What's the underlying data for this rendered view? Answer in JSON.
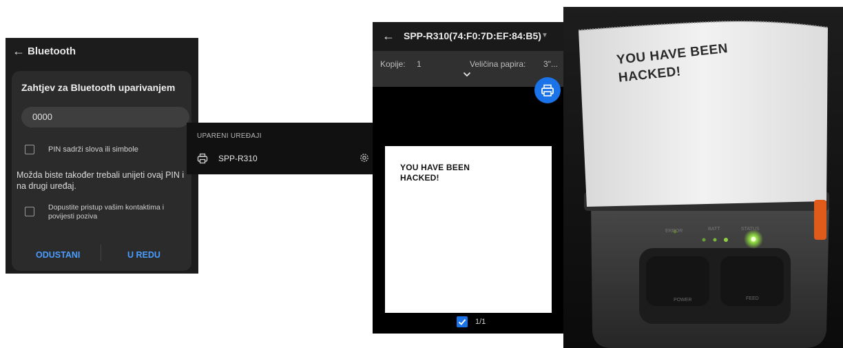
{
  "bluetooth_panel": {
    "title": "Bluetooth",
    "dialog_title": "Zahtjev za Bluetooth uparivanjem",
    "pin_value": "0000",
    "checkbox_pin_label": "PIN sadrži slova ili simbole",
    "note": "Možda biste također trebali unijeti ovaj PIN i na drugi uređaj.",
    "checkbox_contacts_label": "Dopustite pristup vašim kontaktima i povijesti poziva",
    "cancel_label": "ODUSTANI",
    "ok_label": "U REDU"
  },
  "paired_panel": {
    "header": "UPARENI UREĐAJI",
    "device_name": "SPP-R310"
  },
  "print_panel": {
    "title": "SPP-R310(74:F0:7D:EF:84:B5)",
    "copies_label": "Kopije:",
    "copies_value": "1",
    "paper_size_label": "Veličina papira:",
    "paper_size_value": "3\"...",
    "preview_text": "YOU HAVE BEEN HACKED!",
    "page_indicator": "1/1",
    "accent_color": "#1a73e8"
  },
  "photo_panel": {
    "printed_text": "YOU HAVE BEEN HACKED!",
    "led_labels": {
      "error": "ERROR",
      "batt": "BATT",
      "status": "STATUS"
    },
    "button_labels": {
      "power": "POWER",
      "feed": "FEED"
    }
  }
}
